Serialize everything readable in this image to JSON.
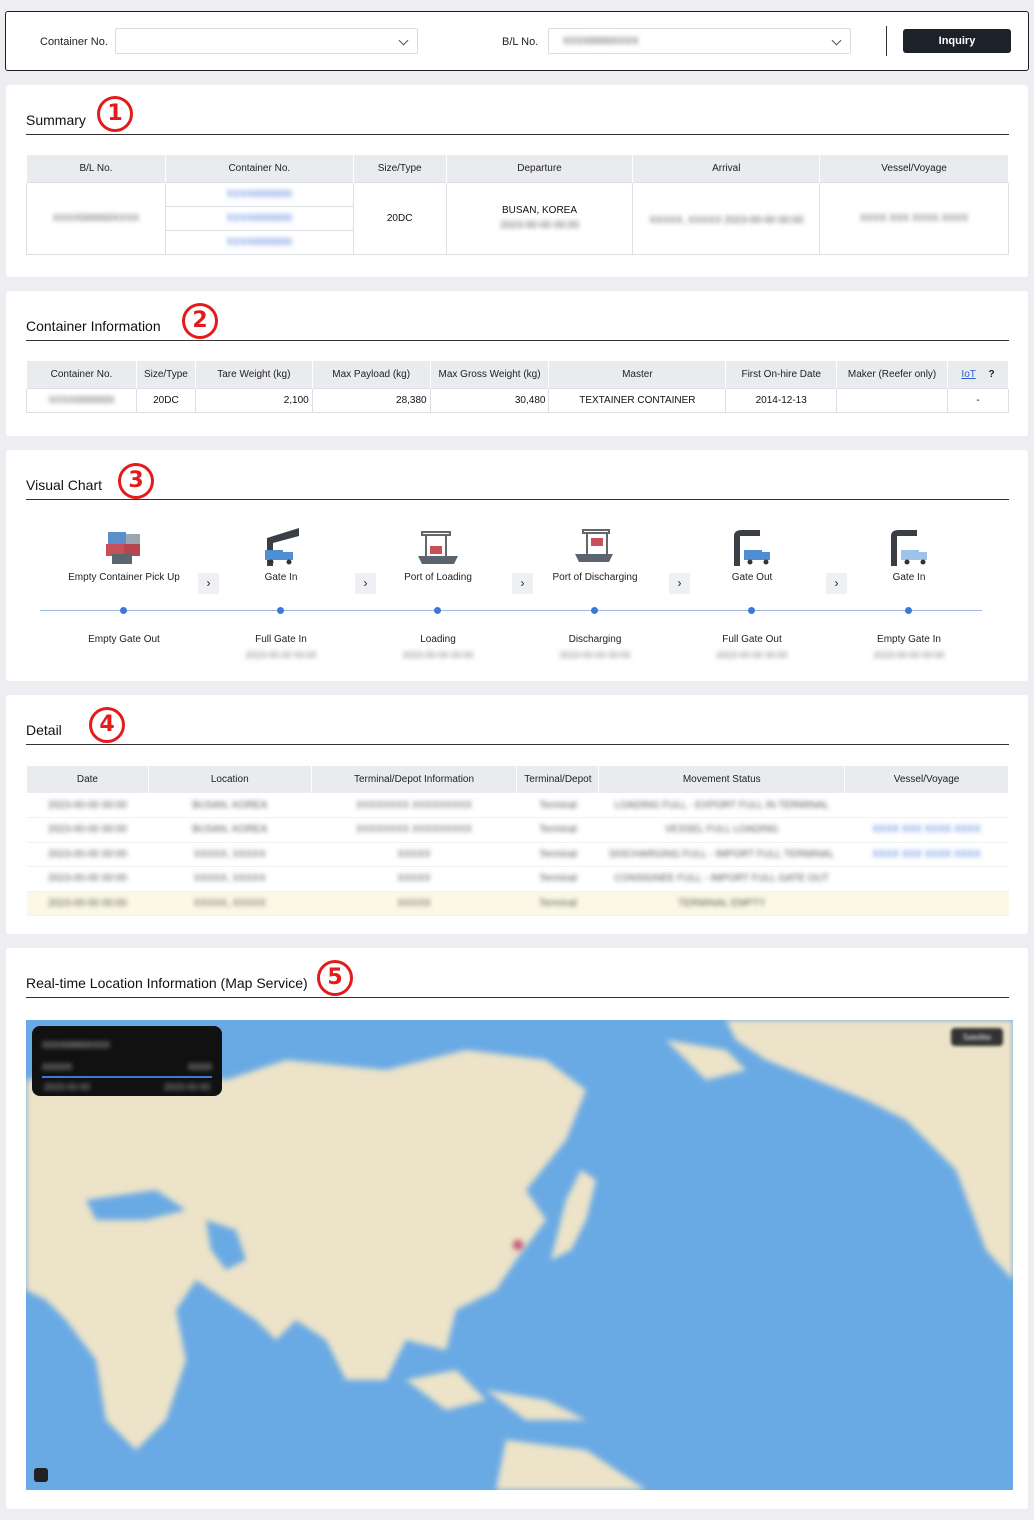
{
  "search": {
    "container_label": "Container No.",
    "container_value": "",
    "bl_label": "B/L No.",
    "bl_value": "XXXX0000XXXX",
    "inquiry_label": "Inquiry"
  },
  "summary": {
    "title": "Summary",
    "badge": "1",
    "headers": [
      "B/L No.",
      "Container No.",
      "Size/Type",
      "Departure",
      "Arrival",
      "Vessel/Voyage"
    ],
    "bl_no": "XXXX000000XXXX",
    "containers": [
      "XXXX0000000",
      "XXXX0000000",
      "XXXX0000000"
    ],
    "size_type": "20DC",
    "departure_place": "BUSAN, KOREA",
    "departure_date": "2023-00-00 00:00",
    "arrival_place": "XXXXX, XXXXX",
    "arrival_date": "2023-00-00 00:00",
    "vessel_voyage": "XXXX XXX XXXX XXXX"
  },
  "container_info": {
    "title": "Container Information",
    "badge": "2",
    "headers": [
      "Container No.",
      "Size/Type",
      "Tare Weight (kg)",
      "Max Payload (kg)",
      "Max Gross Weight (kg)",
      "Master",
      "First On-hire Date",
      "Maker (Reefer only)",
      "IoT",
      "?"
    ],
    "row": {
      "container_no": "XXXX0000000",
      "size_type": "20DC",
      "tare": "2,100",
      "payload": "28,380",
      "gross": "30,480",
      "master": "TEXTAINER CONTAINER",
      "on_hire": "2014-12-13",
      "maker": "",
      "iot": "-"
    }
  },
  "visual_chart": {
    "title": "Visual Chart",
    "badge": "3",
    "stages": [
      "Empty Container Pick Up",
      "Gate In",
      "Port of Loading",
      "Port of Discharging",
      "Gate Out",
      "Gate In"
    ],
    "arrow": "›",
    "events": [
      {
        "label": "Empty Gate Out",
        "date": ""
      },
      {
        "label": "Full Gate In",
        "date": "2023-00-00 00:00"
      },
      {
        "label": "Loading",
        "date": "2023-00-00 00:00"
      },
      {
        "label": "Discharging",
        "date": "2023-00-00 00:00"
      },
      {
        "label": "Full Gate Out",
        "date": "2023-00-00 00:00"
      },
      {
        "label": "Empty Gate In",
        "date": "2023-00-00 00:00"
      }
    ]
  },
  "detail": {
    "title": "Detail",
    "badge": "4",
    "headers": [
      "Date",
      "Location",
      "Terminal/Depot Information",
      "Terminal/Depot",
      "Movement Status",
      "Vessel/Voyage"
    ],
    "rows": [
      [
        "2023-00-00 00:00",
        "BUSAN, KOREA",
        "XXXXXXXX XXXXXXXXX",
        "Terminal",
        "LOADING FULL - EXPORT FULL IN TERMINAL",
        ""
      ],
      [
        "2023-00-00 00:00",
        "BUSAN, KOREA",
        "XXXXXXXX XXXXXXXXX",
        "Terminal",
        "VESSEL FULL LOADING",
        "XXXX XXX XXXX XXXX"
      ],
      [
        "2023-00-00 00:00",
        "XXXXX, XXXXX",
        "XXXXX",
        "Terminal",
        "DISCHARGING FULL - IMPORT FULL TERMINAL",
        "XXXX XXX XXXX XXXX"
      ],
      [
        "2023-00-00 00:00",
        "XXXXX, XXXXX",
        "XXXXX",
        "Terminal",
        "CONSIGNEE FULL - IMPORT FULL GATE OUT",
        ""
      ],
      [
        "2023-00-00 00:00",
        "XXXXX, XXXXX",
        "XXXXX",
        "Terminal",
        "TERMINAL EMPTY",
        ""
      ]
    ]
  },
  "map_section": {
    "title": "Real-time Location Information (Map Service)",
    "badge": "5",
    "card_title": "XXXX0000XXXX",
    "card_from": "XXXXX",
    "card_to": "XXXX",
    "card_d1": "2023-00-00",
    "card_d2": "2023-00-00",
    "map_button": "Satellite"
  }
}
